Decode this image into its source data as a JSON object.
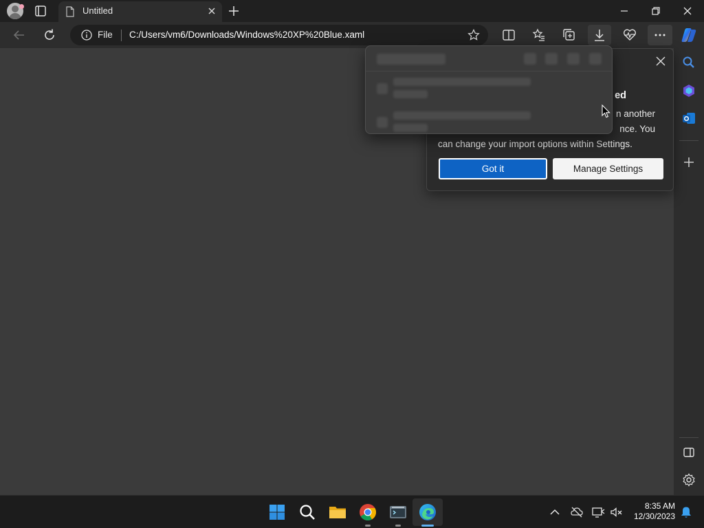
{
  "tab": {
    "title": "Untitled"
  },
  "address_bar": {
    "scheme_label": "File",
    "url": "C:/Users/vm6/Downloads/Windows%20XP%20Blue.xaml"
  },
  "notification": {
    "heading_visible": "ed",
    "line1_visible": "n another",
    "line2_visible": "nce. You",
    "line3": "can change your import options within Settings.",
    "primary_button": "Got it",
    "secondary_button": "Manage Settings"
  },
  "taskbar": {
    "time": "8:35 AM",
    "date": "12/30/2023",
    "pinned": [
      "start-icon",
      "search-icon",
      "file-explorer-icon",
      "chrome-icon",
      "terminal-icon",
      "edge-icon"
    ]
  },
  "colors": {
    "accent": "#0e63c4",
    "page_background": "#3b3b3b",
    "chrome_dark": "#202020"
  }
}
